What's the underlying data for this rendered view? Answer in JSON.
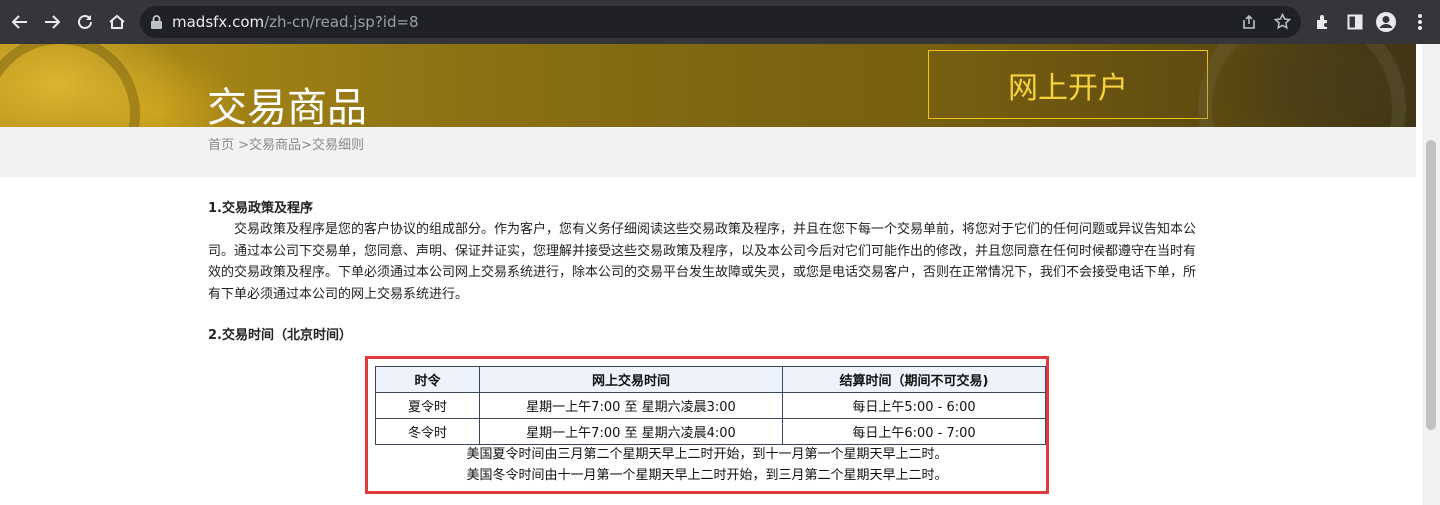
{
  "browser": {
    "url_host": "madsfx.com",
    "url_path": "/zh-cn/read.jsp?id=8"
  },
  "banner": {
    "title": "交易商品",
    "open_account": "网上开户"
  },
  "breadcrumb": {
    "home": "首页",
    "sep1": " >",
    "products": "交易商品",
    "sep2": ">",
    "current": "交易细则"
  },
  "section1": {
    "title": "1.交易政策及程序",
    "body": "交易政策及程序是您的客户协议的组成部分。作为客户，您有义务仔细阅读这些交易政策及程序，并且在您下每一个交易单前，将您对于它们的任何问题或异议告知本公司。通过本公司下交易单，您同意、声明、保证并证实，您理解并接受这些交易政策及程序，以及本公司今后对它们可能作出的修改，并且您同意在任何时候都遵守在当时有效的交易政策及程序。下单必须通过本公司网上交易系统进行，除本公司的交易平台发生故障或失灵，或您是电话交易客户，否则在正常情况下，我们不会接受电话下单，所有下单必须通过本公司的网上交易系统进行。"
  },
  "section2": {
    "title": "2.交易时间（北京时间）",
    "table": {
      "headers": [
        "时令",
        "网上交易时间",
        "结算时间（期间不可交易)"
      ],
      "rows": [
        [
          "夏令时",
          "星期一上午7:00 至 星期六凌晨3:00",
          "每日上午5:00 - 6:00"
        ],
        [
          "冬令时",
          "星期一上午7:00 至 星期六凌晨4:00",
          "每日上午6:00 - 7:00"
        ]
      ]
    },
    "notes": [
      "美国夏令时间由三月第二个星期天早上二时开始，到十一月第一个星期天早上二时。",
      "美国冬令时间由十一月第一个星期天早上二时开始，到三月第二个星期天早上二时。"
    ]
  },
  "colors": {
    "highlight_border": "#e03a3a",
    "open_account_gold": "#f7d23e"
  }
}
